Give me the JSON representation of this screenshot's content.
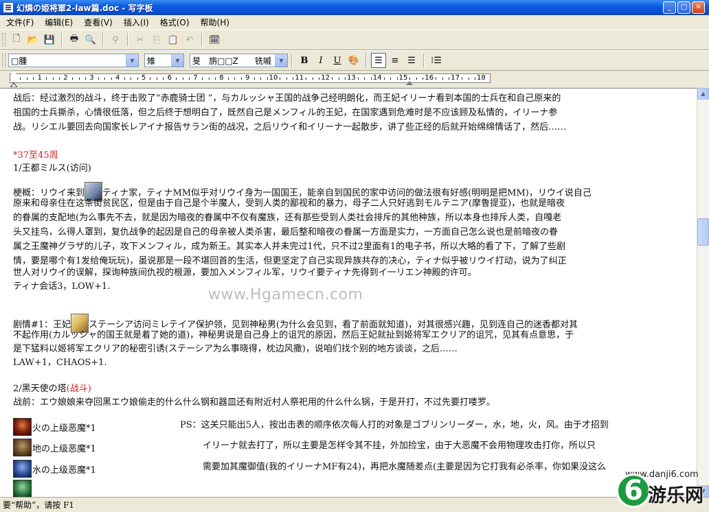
{
  "window": {
    "title": "幻燐の姫将軍2-law篇.doc - 写字板",
    "minimize": "_",
    "maximize": "□",
    "close": "✕"
  },
  "menu": [
    "文件(F)",
    "编辑(E)",
    "查看(V)",
    "插入(I)",
    "格式(O)",
    "帮助(H)"
  ],
  "toolbar": {
    "icons": [
      "new-icon",
      "open-icon",
      "save-icon",
      "print-icon",
      "print-preview-icon",
      "find-icon",
      "cut-icon",
      "copy-icon",
      "paste-icon",
      "undo-icon",
      "datetime-icon"
    ]
  },
  "format_bar": {
    "font_value": "□腫",
    "size_value": "雉",
    "script_value": "旻　旃□□Z　　铣嘁",
    "bold": "B",
    "italic": "I",
    "underline": "U",
    "align_left_pressed": true
  },
  "ruler": {
    "numbers": [
      "1",
      "2",
      "3",
      "4",
      "5",
      "6",
      "7",
      "8",
      "9",
      "10",
      "11",
      "12",
      "13",
      "14",
      "15",
      "16",
      "17",
      "18"
    ]
  },
  "document": {
    "p1_l1": "战后：经过激烈的战斗，终于击败了“赤鹿骑士团 ”，与カルッシャ王国的战争己经明朗化，而王妃イリーナ看到本国的士兵在和自己原来的",
    "p1_l2": "祖国的士兵撕杀，心情很低落，但之后终于想明白了，既然自己是メンフィル的王妃，在国家遇到危难时是不应该顾及私情的，イリーナ参",
    "p1_l3": "战。リシエル要回去向国家长レアイナ报告サラン街的战况，之后リウイ和イリーナ一起散步，讲了些正经的后就开始绵绵情话了，然后……",
    "section_title": "*37至45周",
    "sub1_title": "1/王都ミルス(访问)",
    "p2_l1a": "梗概：リウイ来到",
    "p2_l1b": "ティナ家，ティナMM似乎对リウイ身为一国国王，能亲自到国民的家中访问的做法很有好感(明明是把MM)，リウイ说自己",
    "p2_l2": "原来和母亲住在这条街贫民区，但是由于自己是个半魔人，受到人类的鄙视和的暴力，母子二人只好逃到モルテニア(摩鲁提亚)，也就是暗夜",
    "p2_l3": "的眷属的支配地(为么事先不去，就是因为暗夜的眷属中不仅有魔族，还有那些受到人类社会排斥的其他种族，所以本身也排斥人类，自嘎老",
    "p2_l4": "头又挂鸟，么得人罩到，复仇战争的起因是自己的母亲被人类杀害，最后整和暗夜の眷属一方面是实力，一方面自己怎么说也是前暗夜の眷",
    "p2_l5": "属之王魔神グラザ的儿子，攻下メンフィル，成为新王。其实本人并未完过1代，只不过2里面有1的电子书，所以大略的看了下，了解了些剧",
    "p2_l6": "情，要是哪个有1发给俺玩玩)，虽说那是一段不堪回首的生活，但更坚定了自己实现异族共存的决心，ティナ似乎被リウイ打动，说为了纠正",
    "p2_l7": "世人对リウイ的误解，探询种族间仇视的根源，要加入メンフィル军，リウイ要ティナ先得到イ一リエン神殿的许可。",
    "p2_l8": "ティナ会话3，LOW+1.",
    "p3_l1a": "剧情#1：王妃",
    "p3_l1b": "ステーシア访问ミレテイア保护领，见到神秘男(为什么会见到，看了前面就知道)，对其很感兴趣，见到连自己的迷香都对其",
    "p3_l2": "不起作用(カルッシャ的国王就是着了她的道)，神秘男说是自己身上的诅咒的原因，然后王妃就扯到姬将军エクリア的诅咒，见其有点意思，于",
    "p3_l3": "是下猛料以姬将军エクリア的秘密引诱(ステーシア为么事晓得，枕边风撒)，说咱们找个别的地方谈谈，之后……",
    "p3_l4": "LAW+1，CHAOS+1.",
    "sub2_title": "2/黑天使の塔",
    "sub2_tag": "(战斗)",
    "p4_l1": "战前：エウ娘娘来夺回黑エウ娘偷走的什么什么钢和器皿还有附近村人祭祀用的什么什么锅，于是开打，不过先要打喽罗。",
    "enemy1": "火の上级恶魔*1",
    "enemy2": "地の上级恶魔*1",
    "enemy3": "水の上级恶魔*1",
    "ps1": "PS：这关只能出5人，按出击表的顺序依次每人打的对象是ゴブリンリーダー，水，地，火，风。由于才招到",
    "ps2": "イリーナ就去打了，所以主要是怎样令其不挂，外加捡宝，由于大恶魔不会用物理攻击打你，所以只",
    "ps3": "需要加其魔御值(我的イリーナMF有24)，再把水魔随差点(主要是因为它打我有必杀率，你如果没这么"
  },
  "watermark": "www.Hgamecn.com",
  "status": "要“帮助”，请按 F1",
  "logo": {
    "url": "www.danji6.com",
    "digit": "6",
    "name": "游乐网"
  }
}
